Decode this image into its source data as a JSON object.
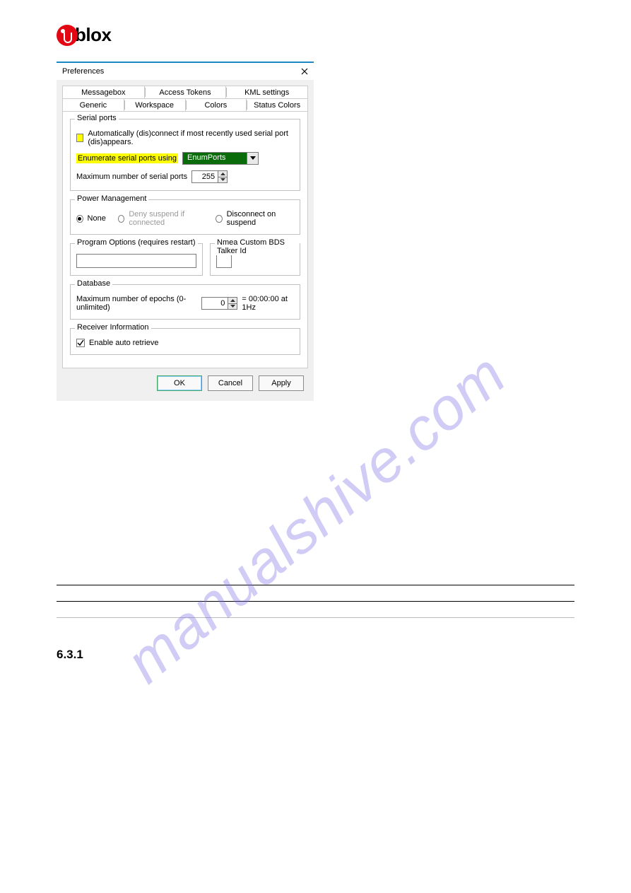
{
  "logo": {
    "text": "blox"
  },
  "watermark": "manualshive.com",
  "section_number": "6.3.1",
  "window": {
    "title": "Preferences",
    "tabs_row1": [
      "Messagebox",
      "Access Tokens",
      "KML settings"
    ],
    "tabs_row2": [
      "Generic",
      "Workspace",
      "Colors",
      "Status Colors"
    ],
    "serial_ports": {
      "legend": "Serial ports",
      "auto_label": "Automatically (dis)connect if most recently used serial port (dis)appears.",
      "enum_label": "Enumerate serial ports using",
      "enum_value": "EnumPorts",
      "max_label": "Maximum number of serial ports",
      "max_value": "255"
    },
    "power": {
      "legend": "Power Management",
      "opt_none": "None",
      "opt_deny": "Deny suspend if connected",
      "opt_disconnect": "Disconnect on suspend"
    },
    "program_options": {
      "legend": "Program Options (requires restart)"
    },
    "nmea": {
      "legend": "Nmea Custom BDS Talker Id"
    },
    "database": {
      "legend": "Database",
      "epochs_label": "Maximum number of epochs (0-unlimited)",
      "epochs_value": "0",
      "suffix": "= 00:00:00 at 1Hz"
    },
    "receiver": {
      "legend": "Receiver Information",
      "auto_retrieve": "Enable auto retrieve"
    },
    "buttons": {
      "ok": "OK",
      "cancel": "Cancel",
      "apply": "Apply"
    }
  }
}
